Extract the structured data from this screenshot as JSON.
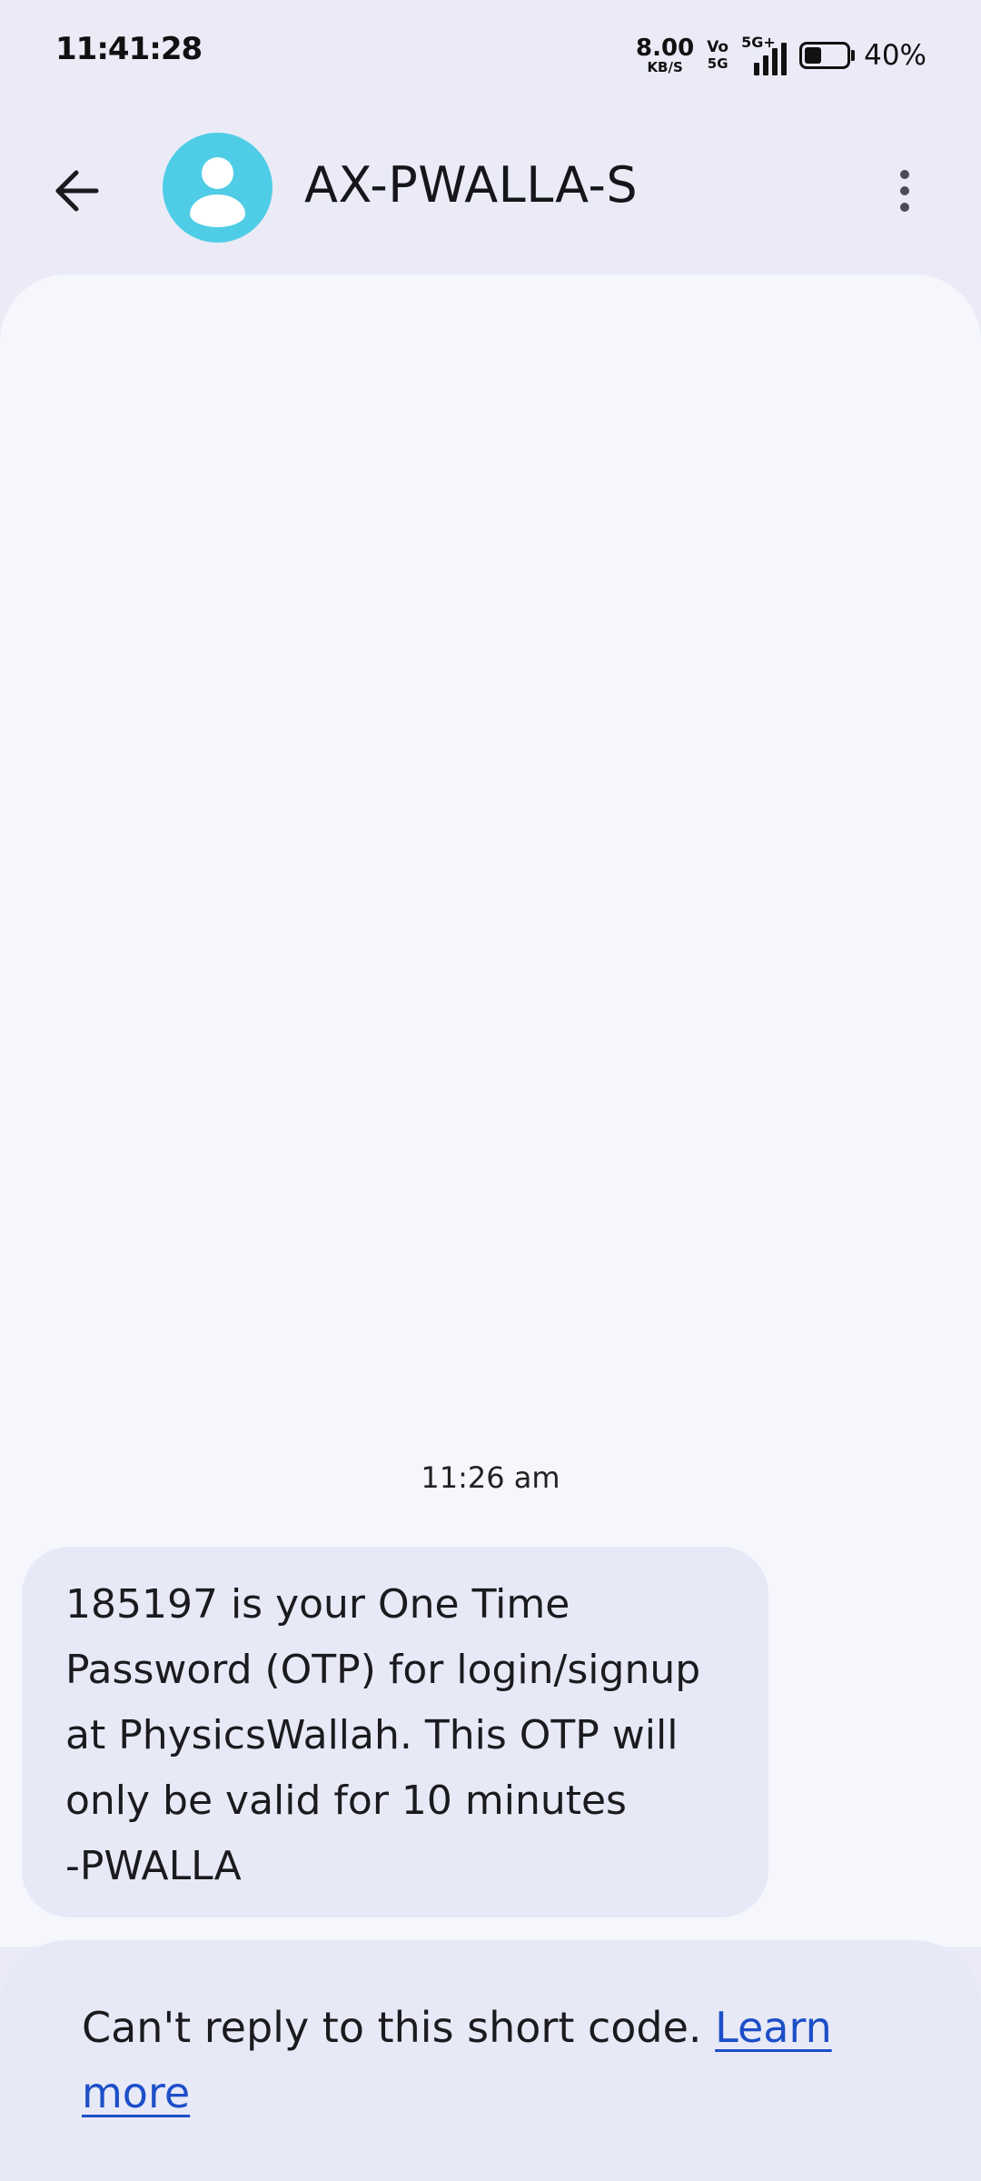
{
  "status_bar": {
    "time": "11:41:28",
    "net_speed_value": "8.00",
    "net_speed_unit": "KB/S",
    "volte_top": "Vo",
    "volte_bottom": "5G",
    "network_type": "5G+",
    "battery_level": 0.4,
    "battery_percent": "40%"
  },
  "app_bar": {
    "back_icon": "arrow-back-icon",
    "avatar_icon": "person-icon",
    "contact_name": "AX-PWALLA-S",
    "more_icon": "more-vert-icon",
    "avatar_color": "#4fcde6"
  },
  "conversation": {
    "timestamp": "11:26 am",
    "message_text": "185197 is your One Time\nPassword (OTP) for login/signup\nat PhysicsWallah. This OTP will\nonly be valid for 10 minutes\n-PWALLA"
  },
  "reply_notice": {
    "text": "Can't reply to this short code. ",
    "link_text": "Learn more",
    "link_color": "#1c4fc8"
  }
}
